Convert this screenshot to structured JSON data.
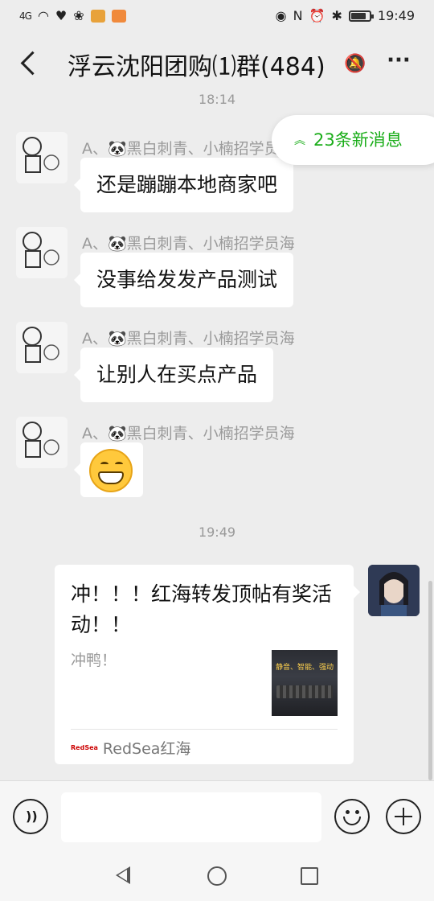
{
  "status_bar": {
    "signal": "4G",
    "time": "19:49",
    "icons": [
      "signal-icon",
      "wifi-icon",
      "heart-app-icon",
      "huawei-icon",
      "app-icon-1",
      "app-icon-2",
      "eye-icon",
      "nfc-icon",
      "alarm-icon",
      "bluetooth-icon",
      "battery-icon"
    ]
  },
  "header": {
    "title": "浮云沈阳团购⑴群(484)",
    "icons": [
      "back-icon",
      "mute-bell-icon",
      "more-icon"
    ]
  },
  "new_messages_pill": {
    "label": "23条新消息",
    "color": "#1aad19"
  },
  "messages": [
    {
      "time": "18:14"
    },
    {
      "sender": "A、🐼黑白刺青、小楠招学员海",
      "text": "还是蹦蹦本地商家吧"
    },
    {
      "sender": "A、🐼黑白刺青、小楠招学员海",
      "text": "没事给发发产品测试"
    },
    {
      "sender": "A、🐼黑白刺青、小楠招学员海",
      "text": "让别人在买点产品"
    },
    {
      "sender": "A、🐼黑白刺青、小楠招学员海",
      "emoji": "grin-emoji"
    },
    {
      "time": "19:49"
    }
  ],
  "shared_card": {
    "title": "冲！！！红海转发顶帖有奖活动！！",
    "description": "冲鸭！",
    "thumbnail_text": "静音、智能、强动",
    "source_logo": "RedSea",
    "source": "RedSea红海"
  },
  "input_bar": {
    "text_value": "",
    "icons": [
      "voice-icon",
      "emoji-icon",
      "plus-icon"
    ]
  },
  "system_nav": {
    "icons": [
      "nav-back-icon",
      "nav-home-icon",
      "nav-recent-icon"
    ]
  }
}
